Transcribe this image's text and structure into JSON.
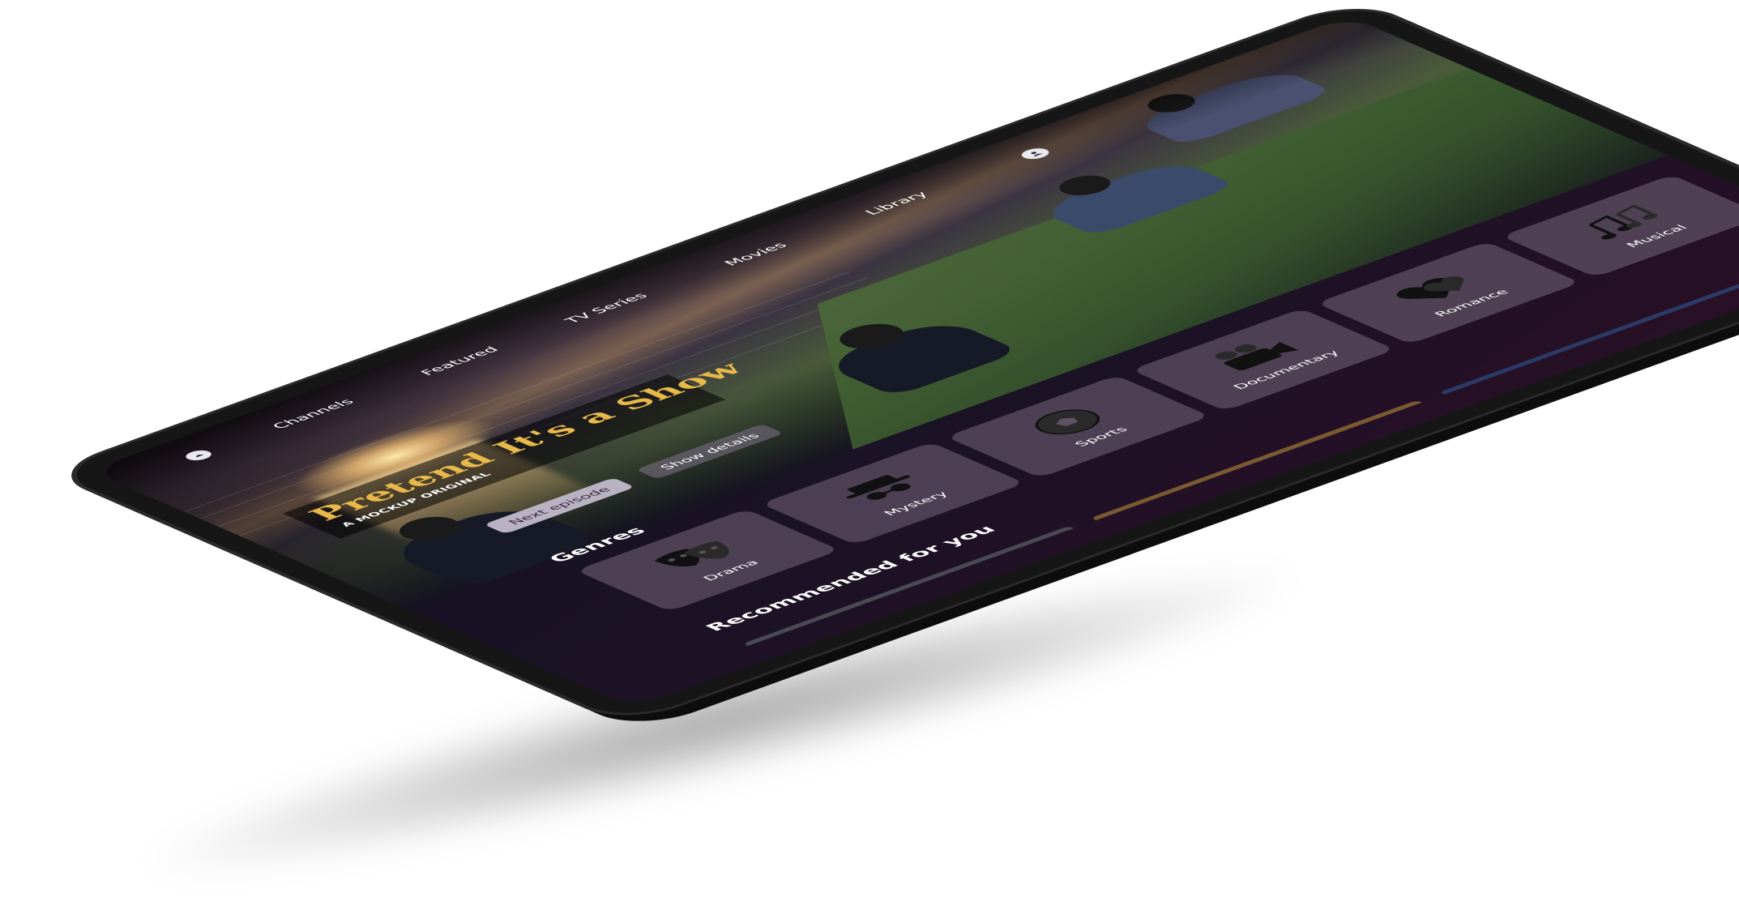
{
  "nav": {
    "items": [
      "Channels",
      "Featured",
      "TV Series",
      "Movies",
      "Library"
    ],
    "logo_icon": "logo-icon",
    "profile_icon": "user-icon"
  },
  "hero": {
    "title": "Pretend It's a Show",
    "subtitle": "A MOCKUP ORIGINAL",
    "primary_button": "Next episode",
    "secondary_button": "Show details"
  },
  "genres": {
    "title": "Genres",
    "items": [
      {
        "label": "Drama",
        "icon": "theater-masks-icon"
      },
      {
        "label": "Mystery",
        "icon": "spy-icon"
      },
      {
        "label": "Sports",
        "icon": "soccer-ball-icon"
      },
      {
        "label": "Documentary",
        "icon": "video-camera-icon"
      },
      {
        "label": "Romance",
        "icon": "hearts-icon"
      },
      {
        "label": "Musical",
        "icon": "music-notes-icon"
      }
    ]
  },
  "recommended": {
    "title": "Recommended for you",
    "strip_colors": [
      "#4a4a55",
      "#7a5a30",
      "#2b3a66"
    ]
  },
  "colors": {
    "accent_title": "#e8b94a",
    "card_bg": "#5f5064"
  }
}
